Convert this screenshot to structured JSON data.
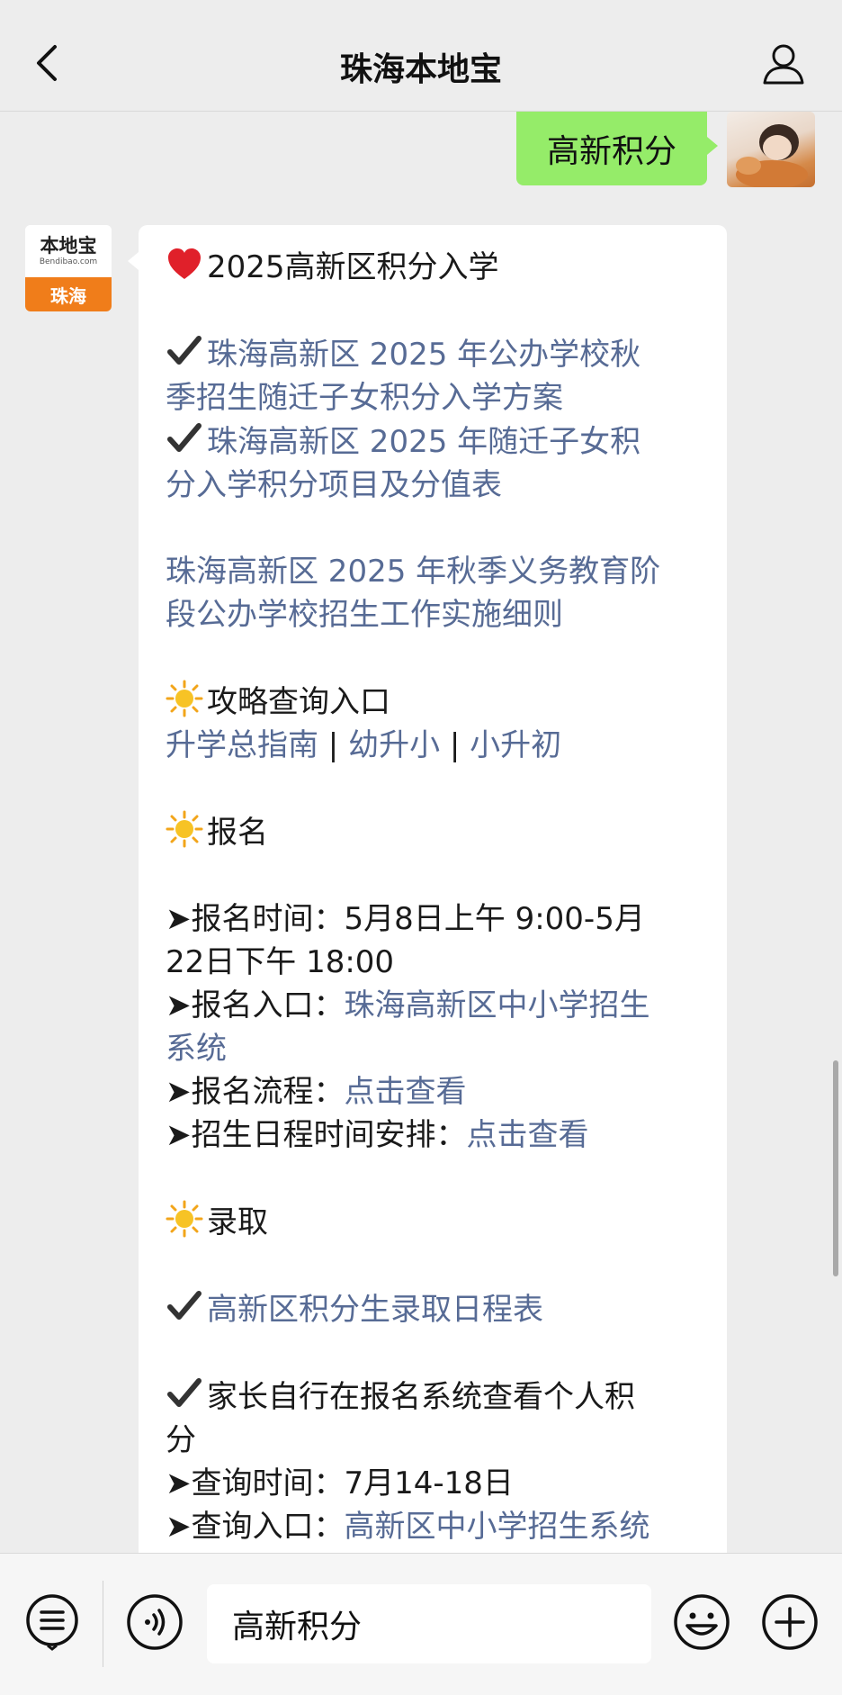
{
  "header": {
    "title": "珠海本地宝"
  },
  "outgoing": {
    "text": "高新积分"
  },
  "bot": {
    "avatar_brand": "本地宝",
    "avatar_domain": "Bendibao.com",
    "avatar_city": "珠海"
  },
  "message": {
    "heading": "2025高新区积分入学",
    "link1_line1": "珠海高新区 2025 年公办学校秋",
    "link1_line2": "季招生随迁子女积分入学方案",
    "link2_line1": "珠海高新区 2025 年随迁子女积",
    "link2_line2": "分入学积分项目及分值表",
    "link3_line1": "珠海高新区 2025 年秋季义务教育阶",
    "link3_line2": "段公办学校招生工作实施细则",
    "section1": "攻略查询入口",
    "guide_links": [
      "升学总指南",
      "幼升小",
      "小升初"
    ],
    "guide_sep": " | ",
    "section2": "报名",
    "reg_time_label": "报名时间：",
    "reg_time_value_1": "5月8日上午 9:00-5月",
    "reg_time_value_2": "22日下午 18:00",
    "reg_entry_label": "报名入口：",
    "reg_entry_link_1": "珠海高新区中小学招生",
    "reg_entry_link_2": "系统",
    "reg_flow_label": "报名流程：",
    "reg_flow_link": "点击查看",
    "schedule_label": "招生日程时间安排：",
    "schedule_link": "点击查看",
    "section3": "录取",
    "admit_link": "高新区积分生录取日程表",
    "check_line1": "家长自行在报名系统查看个人积",
    "check_line2": "分",
    "query_time_label": "查询时间：",
    "query_time_value": "7月14-18日",
    "query_entry_label": "查询入口：",
    "query_entry_link": "高新区中小学招生系统"
  },
  "input": {
    "value": "高新积分"
  },
  "icons": {
    "back": "chevron-left-icon",
    "profile": "person-icon",
    "heart": "red-heart-emoji",
    "check": "check-mark-emoji",
    "sun": "sun-emoji",
    "arrow": "arrowhead-bullet",
    "menu": "menu-list-icon",
    "voice": "voice-icon",
    "emoji": "emoji-face-icon",
    "plus": "plus-icon"
  },
  "colors": {
    "link": "#576b95",
    "outgoing_bubble": "#95ec69",
    "background": "#ededed"
  }
}
